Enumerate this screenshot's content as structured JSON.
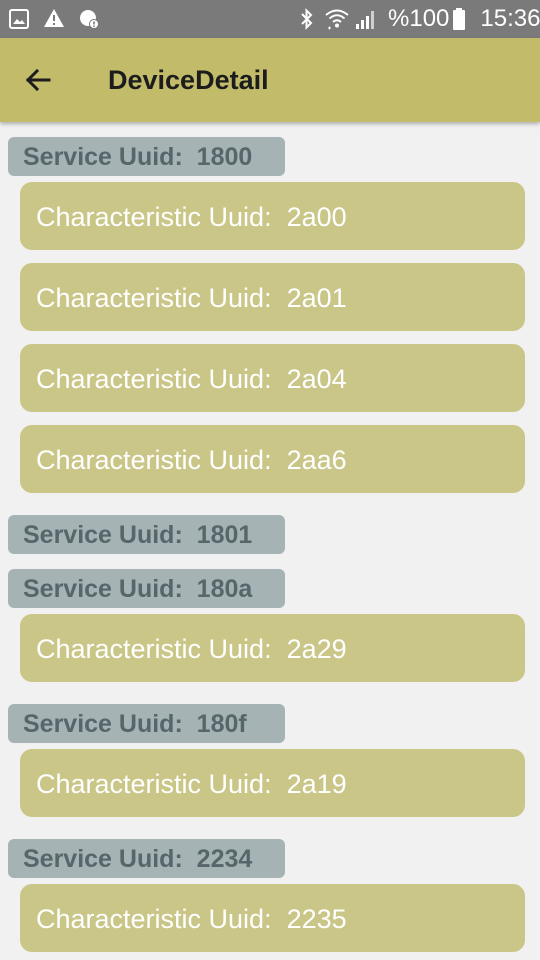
{
  "status_bar": {
    "battery_text": "%100",
    "time": "15:36",
    "icons": [
      "image-notification-icon",
      "warning-icon",
      "data-saver-icon",
      "bluetooth-icon",
      "wifi-icon",
      "signal-icon",
      "battery-icon"
    ]
  },
  "app_bar": {
    "title": "DeviceDetail",
    "back_icon": "arrow-back-icon",
    "background": "#c2bc6a"
  },
  "services": [
    {
      "label": "Service Uuid:  1800",
      "characteristics": [
        "Characteristic Uuid:  2a00",
        "Characteristic Uuid:  2a01",
        "Characteristic Uuid:  2a04",
        "Characteristic Uuid:  2aa6"
      ]
    },
    {
      "label": "Service Uuid:  1801",
      "characteristics": []
    },
    {
      "label": "Service Uuid:  180a",
      "characteristics": [
        "Characteristic Uuid:  2a29"
      ]
    },
    {
      "label": "Service Uuid:  180f",
      "characteristics": [
        "Characteristic Uuid:  2a19"
      ]
    },
    {
      "label": "Service Uuid:  2234",
      "characteristics": [
        "Characteristic Uuid:  2235"
      ]
    }
  ],
  "colors": {
    "service_chip": "#a5b3b5",
    "characteristic_card": "#c9c687",
    "background": "#f1f1f1"
  }
}
